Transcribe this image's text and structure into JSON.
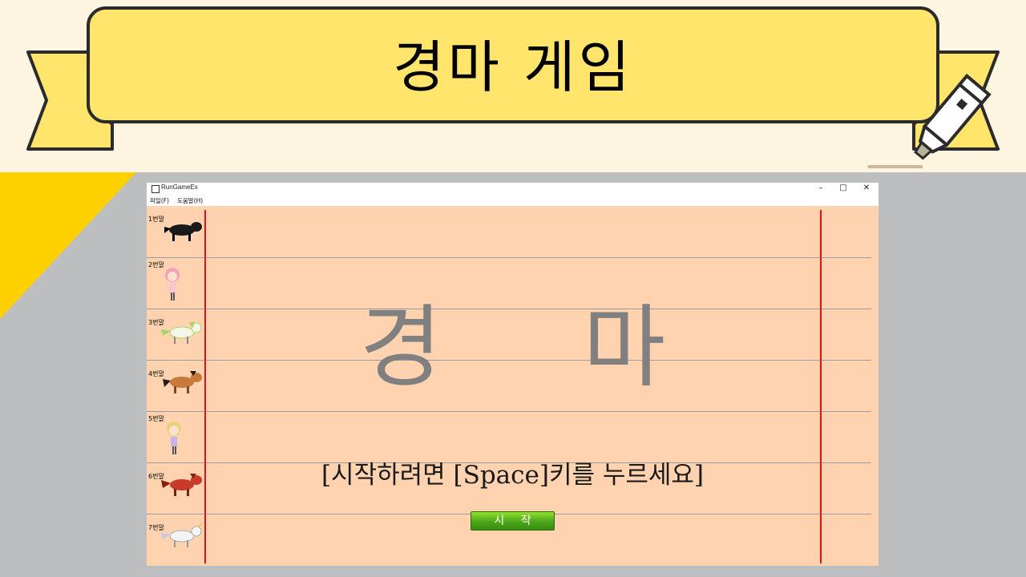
{
  "banner": {
    "title": "경마 게임"
  },
  "window": {
    "title": "RunGameEx",
    "controls": {
      "minimize": "–",
      "maximize": "□",
      "close": "✕"
    },
    "menu": [
      "파일(F)",
      "도움말(H)"
    ]
  },
  "game": {
    "big_title": "경 마",
    "hint": "[시작하려면 [Space]키를 누르세요]",
    "start_button": "시 작",
    "lanes": [
      {
        "label": "1번말",
        "sprite": "black-horse-icon",
        "color": "#1a1a1a"
      },
      {
        "label": "2번말",
        "sprite": "pink-girl-icon",
        "color": "#f2a4b5"
      },
      {
        "label": "3번말",
        "sprite": "green-horse-icon",
        "color": "#a8d46a"
      },
      {
        "label": "4번말",
        "sprite": "brown-horse-icon",
        "color": "#c87a3a"
      },
      {
        "label": "5번말",
        "sprite": "blonde-girl-icon",
        "color": "#e6d27a"
      },
      {
        "label": "6번말",
        "sprite": "red-horse-icon",
        "color": "#c83a2a"
      },
      {
        "label": "7번말",
        "sprite": "white-unicorn-icon",
        "color": "#f4f4f4"
      }
    ]
  },
  "colors": {
    "banner_yellow": "#ffe56b",
    "field": "#ffd3b0",
    "finish_line": "#e81010",
    "button": "#4aa51a"
  }
}
